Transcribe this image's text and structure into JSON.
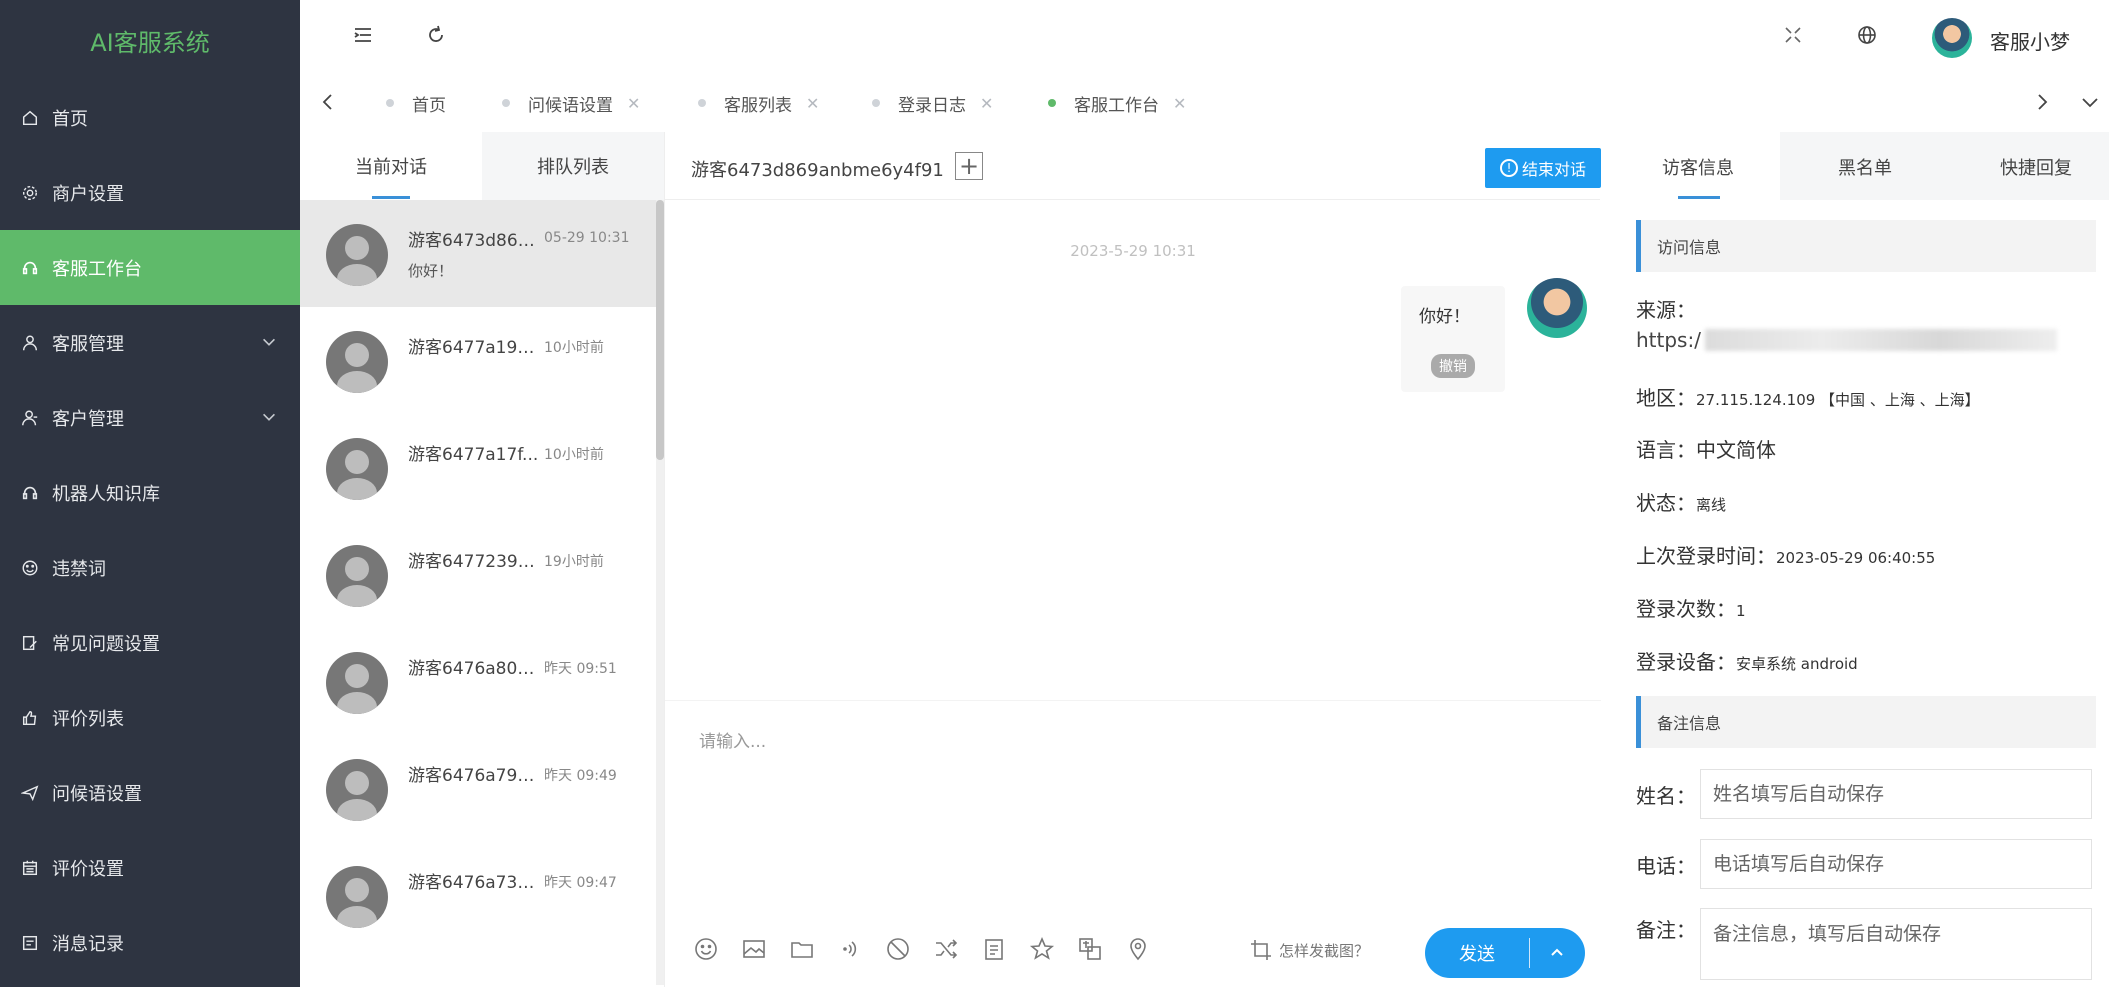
{
  "colors": {
    "sidebar_bg": "#2e3441",
    "accent_green": "#5fba6a",
    "primary_blue": "#1e9bf0"
  },
  "sidebar": {
    "brand": "AI客服系统",
    "items": [
      {
        "label": "首页",
        "icon": "home-icon"
      },
      {
        "label": "商户设置",
        "icon": "gear-icon"
      },
      {
        "label": "客服工作台",
        "icon": "headset-icon",
        "active": true
      },
      {
        "label": "客服管理",
        "icon": "user-icon",
        "expandable": true
      },
      {
        "label": "客户管理",
        "icon": "user-group-icon",
        "expandable": true
      },
      {
        "label": "机器人知识库",
        "icon": "robot-icon"
      },
      {
        "label": "违禁词",
        "icon": "smile-icon"
      },
      {
        "label": "常见问题设置",
        "icon": "edit-icon"
      },
      {
        "label": "评价列表",
        "icon": "thumbs-up-icon"
      },
      {
        "label": "问候语设置",
        "icon": "send-icon"
      },
      {
        "label": "评价设置",
        "icon": "calendar-icon"
      },
      {
        "label": "消息记录",
        "icon": "message-icon"
      }
    ]
  },
  "header": {
    "user_name": "客服小梦"
  },
  "tabs": [
    {
      "label": "首页",
      "closable": false
    },
    {
      "label": "问候语设置",
      "closable": true
    },
    {
      "label": "客服列表",
      "closable": true
    },
    {
      "label": "登录日志",
      "closable": true
    },
    {
      "label": "客服工作台",
      "closable": true,
      "active": true
    }
  ],
  "conversations": {
    "tab_current": "当前对话",
    "tab_queue": "排队列表",
    "items": [
      {
        "name": "游客6473d869...",
        "time": "05-29 10:31",
        "message": "你好！"
      },
      {
        "name": "游客6477a19e...",
        "time": "10小时前",
        "message": ""
      },
      {
        "name": "游客6477a17f...",
        "time": "10小时前",
        "message": ""
      },
      {
        "name": "游客6477239c...",
        "time": "19小时前",
        "message": ""
      },
      {
        "name": "游客6476a808...",
        "time": "昨天 09:51",
        "message": ""
      },
      {
        "name": "游客6476a79a...",
        "time": "昨天 09:49",
        "message": ""
      },
      {
        "name": "游客6476a73d...",
        "time": "昨天 09:47",
        "message": ""
      }
    ]
  },
  "chat": {
    "visitor_id": "游客6473d869anbme6y4f91",
    "end_button": "结束对话",
    "timestamp": "2023-5-29 10:31",
    "message_text": "你好！",
    "revoke_label": "撤销",
    "input_placeholder": "请输入...",
    "screenshot_hint": "怎样发截图？",
    "send_label": "发送",
    "tools": [
      "emoji-icon",
      "image-icon",
      "folder-icon",
      "voice-icon",
      "block-icon",
      "transfer-icon",
      "note-icon",
      "star-icon",
      "translate-icon",
      "location-icon"
    ]
  },
  "info": {
    "tab_visitor": "访客信息",
    "tab_blacklist": "黑名单",
    "tab_quick_reply": "快捷回复",
    "section_visit": "访问信息",
    "source_label": "来源：",
    "source_prefix": "https:/",
    "region_label": "地区：",
    "region_value": "27.115.124.109 【中国 、上海 、上海】",
    "language_label": "语言：",
    "language_value": "中文简体",
    "status_label": "状态：",
    "status_value": "离线",
    "last_login_label": "上次登录时间：",
    "last_login_value": "2023-05-29 06:40:55",
    "login_count_label": "登录次数：",
    "login_count_value": "1",
    "device_label": "登录设备：",
    "device_value": "安卓系统 android",
    "section_notes": "备注信息",
    "name_label": "姓名：",
    "name_placeholder": "姓名填写后自动保存",
    "phone_label": "电话：",
    "phone_placeholder": "电话填写后自动保存",
    "note_label": "备注：",
    "note_placeholder": "备注信息，填写后自动保存"
  }
}
